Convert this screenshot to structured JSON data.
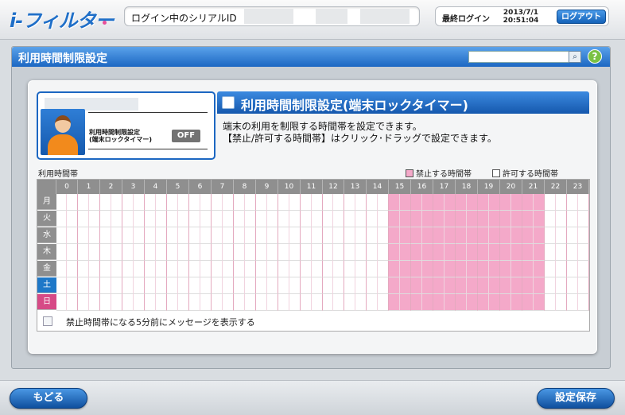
{
  "app": {
    "logo": "i-フィルター"
  },
  "header": {
    "serial_label": "ログイン中のシリアルID",
    "last_login_label": "最終ログイン",
    "last_login_date": "2013/7/1",
    "last_login_time": "20:51:04",
    "logout_label": "ログアウト"
  },
  "panel": {
    "title": "利用時間制限設定",
    "search_value": ""
  },
  "user": {
    "lock_label_line1": "利用時間制限設定",
    "lock_label_line2": "(端末ロックタイマー)",
    "status": "OFF"
  },
  "section": {
    "title": "利用時間制限設定(端末ロックタイマー)",
    "desc_line1": "端末の利用を制限する時間帯を設定できます。",
    "desc_line2": "【禁止/許可する時間帯】はクリック･ドラッグで設定できます。"
  },
  "grid": {
    "title": "利用時間帯",
    "legend_forbidden": "禁止する時間帯",
    "legend_allowed": "許可する時間帯",
    "hours": [
      "0",
      "1",
      "2",
      "3",
      "4",
      "5",
      "6",
      "7",
      "8",
      "9",
      "10",
      "11",
      "12",
      "13",
      "14",
      "15",
      "16",
      "17",
      "18",
      "19",
      "20",
      "21",
      "22",
      "23"
    ],
    "days": [
      "月",
      "火",
      "水",
      "木",
      "金",
      "土",
      "日"
    ],
    "forbidden_hours": [
      15,
      16,
      17,
      18,
      19,
      20,
      21
    ],
    "colors": {
      "forbidden": "#f4a9c9",
      "allowed": "#ffffff"
    }
  },
  "message_option": {
    "label": "禁止時間帯になる5分前にメッセージを表示する",
    "checked": false
  },
  "footer": {
    "back_label": "もどる",
    "save_label": "設定保存"
  }
}
